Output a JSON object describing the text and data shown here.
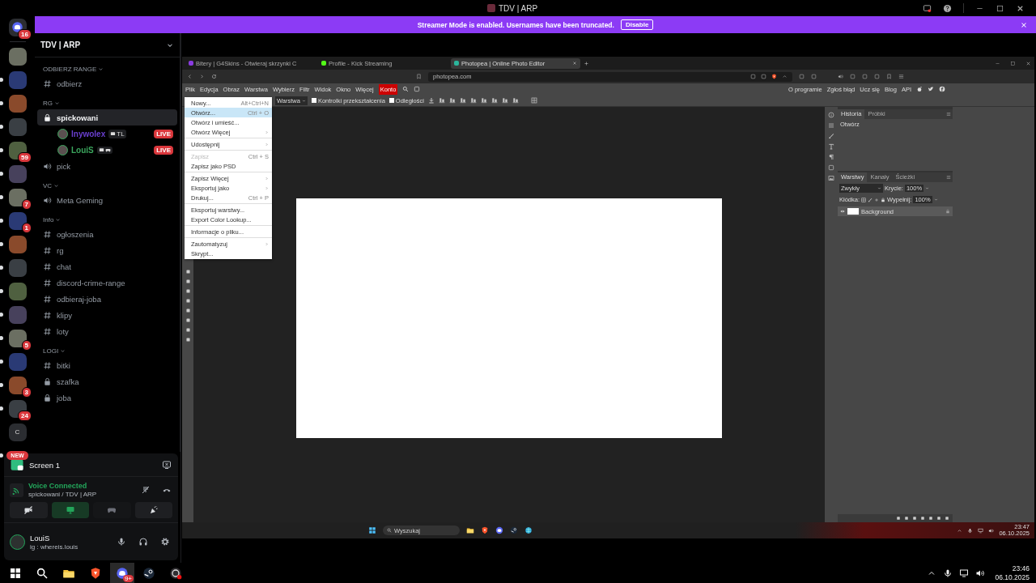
{
  "window": {
    "title": "TDV | ARP"
  },
  "banner": {
    "text": "Streamer Mode is enabled. Usernames have been truncated.",
    "button": "Disable"
  },
  "servers": [
    {
      "kind": "home",
      "badge": "16",
      "unread": false
    },
    {
      "kind": "image",
      "unread": false
    },
    {
      "kind": "image",
      "unread": true
    },
    {
      "kind": "image",
      "unread": true
    },
    {
      "kind": "image",
      "unread": true
    },
    {
      "kind": "image",
      "badge": "59",
      "unread": true
    },
    {
      "kind": "image",
      "unread": true
    },
    {
      "kind": "image",
      "badge": "7",
      "unread": true
    },
    {
      "kind": "image",
      "badge": "1",
      "unread": true
    },
    {
      "kind": "image",
      "unread": true
    },
    {
      "kind": "image",
      "unread": true
    },
    {
      "kind": "image",
      "unread": true
    },
    {
      "kind": "image",
      "unread": true
    },
    {
      "kind": "image",
      "badge": "5",
      "unread": true
    },
    {
      "kind": "image",
      "unread": true
    },
    {
      "kind": "image",
      "badge": "3",
      "unread": true
    },
    {
      "kind": "image",
      "badge": "24",
      "unread": true
    },
    {
      "kind": "text",
      "label": "C",
      "unread": false
    },
    {
      "kind": "new",
      "label": "NEW",
      "unread": true
    }
  ],
  "server_header": {
    "name": "TDV | ARP"
  },
  "categories": [
    {
      "name": "ODBIERZ RANGE",
      "channels": [
        {
          "name": "odbierz",
          "kind": "text",
          "selected": false
        }
      ]
    },
    {
      "name": "RG",
      "channels": [
        {
          "name": "spickowani",
          "kind": "locked",
          "selected": true,
          "members": [
            {
              "name": "lnywolex",
              "tag": "TL",
              "live": "LIVE",
              "color": "#6a3fd0"
            },
            {
              "name": "LouiS",
              "live": "LIVE",
              "color": "#3ba55d"
            }
          ]
        },
        {
          "name": "pick",
          "kind": "voice",
          "selected": false
        }
      ]
    },
    {
      "name": "VC",
      "channels": [
        {
          "name": "Meta Geming",
          "kind": "voice",
          "selected": false
        }
      ]
    },
    {
      "name": "Info",
      "channels": [
        {
          "name": "ogłoszenia",
          "kind": "text",
          "selected": false
        },
        {
          "name": "rg",
          "kind": "text",
          "selected": false
        },
        {
          "name": "chat",
          "kind": "text",
          "selected": false
        },
        {
          "name": "discord-crime-range",
          "kind": "text",
          "selected": false
        },
        {
          "name": "odbieraj-joba",
          "kind": "text",
          "selected": false
        },
        {
          "name": "klipy",
          "kind": "text",
          "selected": false
        },
        {
          "name": "loty",
          "kind": "text",
          "selected": false
        }
      ]
    },
    {
      "name": "LOGI",
      "channels": [
        {
          "name": "bitki",
          "kind": "text",
          "selected": false
        },
        {
          "name": "szafka",
          "kind": "locked",
          "selected": false
        },
        {
          "name": "joba",
          "kind": "locked",
          "selected": false
        }
      ]
    }
  ],
  "stream_tile": {
    "title": "Screen 1"
  },
  "voice": {
    "status": "Voice Connected",
    "channel": "spickowani / TDV | ARP",
    "controls": [
      {
        "kind": "camera",
        "on": false
      },
      {
        "kind": "screen",
        "on": true
      },
      {
        "kind": "activity",
        "on": false
      },
      {
        "kind": "soundboard",
        "on": false
      }
    ]
  },
  "user": {
    "name": "LouiS",
    "status": "ig : whereis.louis"
  },
  "shared_screen": {
    "browser_tabs": [
      {
        "title": "Bitery | G4Skins - Otwieraj skrzynki C",
        "selected": false
      },
      {
        "title": "Profile - Kick Streaming",
        "selected": false
      },
      {
        "title": "Photopea | Online Photo Editor",
        "selected": true
      }
    ],
    "address": "photopea.com",
    "menu": [
      {
        "label": "Plik",
        "kind": "item"
      },
      {
        "label": "Edycja",
        "kind": "item"
      },
      {
        "label": "Obraz",
        "kind": "item"
      },
      {
        "label": "Warstwa",
        "kind": "item"
      },
      {
        "label": "Wybierz",
        "kind": "item"
      },
      {
        "label": "Filtr",
        "kind": "item"
      },
      {
        "label": "Widok",
        "kind": "item"
      },
      {
        "label": "Okno",
        "kind": "item"
      },
      {
        "label": "Więcej",
        "kind": "item"
      },
      {
        "label": "Konto",
        "kind": "account"
      }
    ],
    "links": [
      "O programie",
      "Zgłoś błąd",
      "Ucz się",
      "Blog",
      "API"
    ],
    "toolbar": {
      "dropdown": "Warstwa",
      "checks": [
        {
          "label": "Kontrolki przekształcenia",
          "checked": false
        },
        {
          "label": "Odległości",
          "checked": false
        }
      ]
    },
    "file_menu": [
      [
        {
          "label": "Nowy...",
          "shortcut": "Alt+Ctrl+N",
          "selected": false,
          "disabled": false,
          "submenu": false
        },
        {
          "label": "Otwórz...",
          "shortcut": "Ctrl + O",
          "selected": true,
          "disabled": false,
          "submenu": false
        },
        {
          "label": "Otwórz i umieść...",
          "selected": false,
          "disabled": false,
          "submenu": false
        },
        {
          "label": "Otwórz Więcej",
          "selected": false,
          "disabled": false,
          "submenu": true
        }
      ],
      [
        {
          "label": "Udostępnij",
          "selected": false,
          "disabled": false,
          "submenu": true
        }
      ],
      [
        {
          "label": "Zapisz",
          "shortcut": "Ctrl + S",
          "selected": false,
          "disabled": true,
          "submenu": false
        },
        {
          "label": "Zapisz jako PSD",
          "selected": false,
          "disabled": false,
          "submenu": false
        }
      ],
      [
        {
          "label": "Zapisz Więcej",
          "selected": false,
          "disabled": false,
          "submenu": true
        },
        {
          "label": "Eksportuj jako",
          "selected": false,
          "disabled": false,
          "submenu": true
        },
        {
          "label": "Drukuj...",
          "shortcut": "Ctrl + P",
          "selected": false,
          "disabled": false,
          "submenu": false
        }
      ],
      [
        {
          "label": "Eksportuj warstwy...",
          "selected": false,
          "disabled": false,
          "submenu": false
        },
        {
          "label": "Export Color Lookup...",
          "selected": false,
          "disabled": false,
          "submenu": false
        }
      ],
      [
        {
          "label": "Informacje o pliku...",
          "selected": false,
          "disabled": false,
          "submenu": false
        }
      ],
      [
        {
          "label": "Zautomatyzuj",
          "selected": false,
          "disabled": false,
          "submenu": true
        },
        {
          "label": "Skrypt...",
          "selected": false,
          "disabled": false,
          "submenu": false
        }
      ]
    ],
    "history": {
      "tabs": [
        {
          "label": "Historia",
          "selected": true
        },
        {
          "label": "Próbki",
          "selected": false
        }
      ],
      "items": [
        "Otwórz"
      ]
    },
    "layers": {
      "tabs": [
        {
          "label": "Warstwy",
          "selected": true
        },
        {
          "label": "Kanały",
          "selected": false
        },
        {
          "label": "Ścieżki",
          "selected": false
        }
      ],
      "blend": "Zwykły",
      "opacity_label": "Krycie:",
      "opacity": "100%",
      "lock_label": "Kłódka:",
      "fill_label": "Wypełnij:",
      "fill": "100%",
      "items": [
        {
          "name": "Background",
          "visible": true
        }
      ]
    },
    "taskbar": {
      "search": "Wyszukaj",
      "time": "23:47",
      "date": "06.10.2025"
    }
  },
  "taskbar": {
    "apps": [
      {
        "kind": "start",
        "selected": false
      },
      {
        "kind": "search",
        "selected": false
      },
      {
        "kind": "files",
        "selected": false
      },
      {
        "kind": "brave",
        "selected": false
      },
      {
        "kind": "discord",
        "selected": true,
        "badge": "9+"
      },
      {
        "kind": "steam",
        "selected": false
      },
      {
        "kind": "obs",
        "selected": false
      }
    ],
    "time": "23:46",
    "date": "06.10.2025"
  }
}
